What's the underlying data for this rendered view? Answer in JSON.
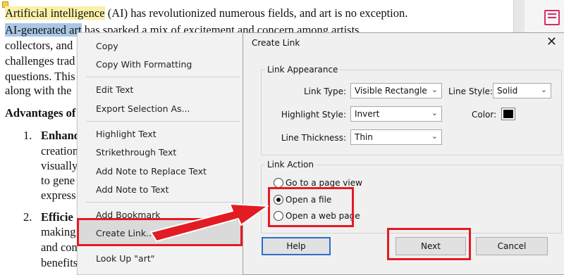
{
  "document": {
    "line1a": "Artificial intelligence",
    "line1b": " (AI) has revolutionized numerous fields, and art is no exception.",
    "line2a": "AI-generated art",
    "line2b": " has sparked a mix of excitement and concern among artists,",
    "line3": "collectors, and",
    "line4": "challenges trad",
    "line5": "questions. This",
    "line6": "along with the",
    "heading": "Advantages of",
    "item1_num": "1.",
    "item1_title": "Enhanc",
    "item1_l2": "creation",
    "item1_l3": "visually",
    "item1_l4": "to gene",
    "item1_l5": "express",
    "item2_num": "2.",
    "item2_title": "Efficie",
    "item2_l2": "making",
    "item2_l3": "and con",
    "item2_l4": "benefits"
  },
  "context_menu": {
    "items": [
      "Copy",
      "Copy With Formatting",
      "Edit Text",
      "Export Selection As...",
      "Highlight Text",
      "Strikethrough Text",
      "Add Note to Replace Text",
      "Add Note to Text",
      "Add Bookmark",
      "Create Link...",
      "Look Up \"art\""
    ]
  },
  "dialog": {
    "title": "Create Link",
    "appearance_group": "Link Appearance",
    "link_type_label": "Link Type:",
    "link_type_value": "Visible Rectangle",
    "line_style_label": "Line Style:",
    "line_style_value": "Solid",
    "highlight_style_label": "Highlight Style:",
    "highlight_style_value": "Invert",
    "color_label": "Color:",
    "color_value": "#000000",
    "line_thickness_label": "Line Thickness:",
    "line_thickness_value": "Thin",
    "action_group": "Link Action",
    "radio_options": [
      "Go to a page view",
      "Open a file",
      "Open a web page"
    ],
    "selected_option": "Open a file",
    "help_label": "Help",
    "next_label": "Next",
    "cancel_label": "Cancel"
  },
  "colors": {
    "annotation_red": "#e31b23",
    "highlight_yellow": "#fbf0a8",
    "selection_blue": "#a9c8e6"
  }
}
